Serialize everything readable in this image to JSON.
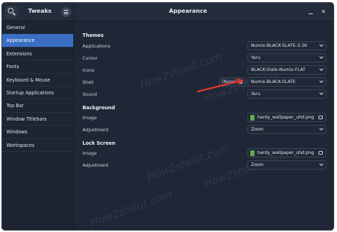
{
  "window": {
    "app_title": "Tweaks",
    "page_title": "Appearance"
  },
  "sidebar": {
    "items": [
      {
        "label": "General"
      },
      {
        "label": "Appearance"
      },
      {
        "label": "Extensions"
      },
      {
        "label": "Fonts"
      },
      {
        "label": "Keyboard & Mouse"
      },
      {
        "label": "Startup Applications"
      },
      {
        "label": "Top Bar"
      },
      {
        "label": "Window Titlebars"
      },
      {
        "label": "Windows"
      },
      {
        "label": "Workspaces"
      }
    ],
    "selected_index": 1
  },
  "themes": {
    "heading": "Themes",
    "applications": {
      "label": "Applications",
      "value": "Numix-BLACK-SLATE-3.36"
    },
    "cursor": {
      "label": "Cursor",
      "value": "Yaru"
    },
    "icons": {
      "label": "Icons",
      "value": "BLACK-Slate-Numix-FLAT"
    },
    "shell": {
      "label": "Shell",
      "value": "Numix-BLACK-SLATE",
      "reset_label": "(None)"
    },
    "sound": {
      "label": "Sound",
      "value": "Yaru"
    }
  },
  "background": {
    "heading": "Background",
    "image": {
      "label": "Image",
      "value": "hardy_wallpaper_uhd.png"
    },
    "adjustment": {
      "label": "Adjustment",
      "value": "Zoom"
    }
  },
  "lock_screen": {
    "heading": "Lock Screen",
    "image": {
      "label": "Image",
      "value": "hardy_wallpaper_uhd.png"
    },
    "adjustment": {
      "label": "Adjustment",
      "value": "Zoom"
    }
  },
  "watermark": "How2shout.com",
  "colors": {
    "selection": "#3a6fc4",
    "annotation_arrow": "#e0392f",
    "window_bg": "#1f2736"
  },
  "icons": {
    "search": "search-icon",
    "menu": "hamburger-menu-icon",
    "minimize": "minimize-icon",
    "close": "close-icon",
    "file": "image-file-icon",
    "picture": "picture-icon"
  }
}
